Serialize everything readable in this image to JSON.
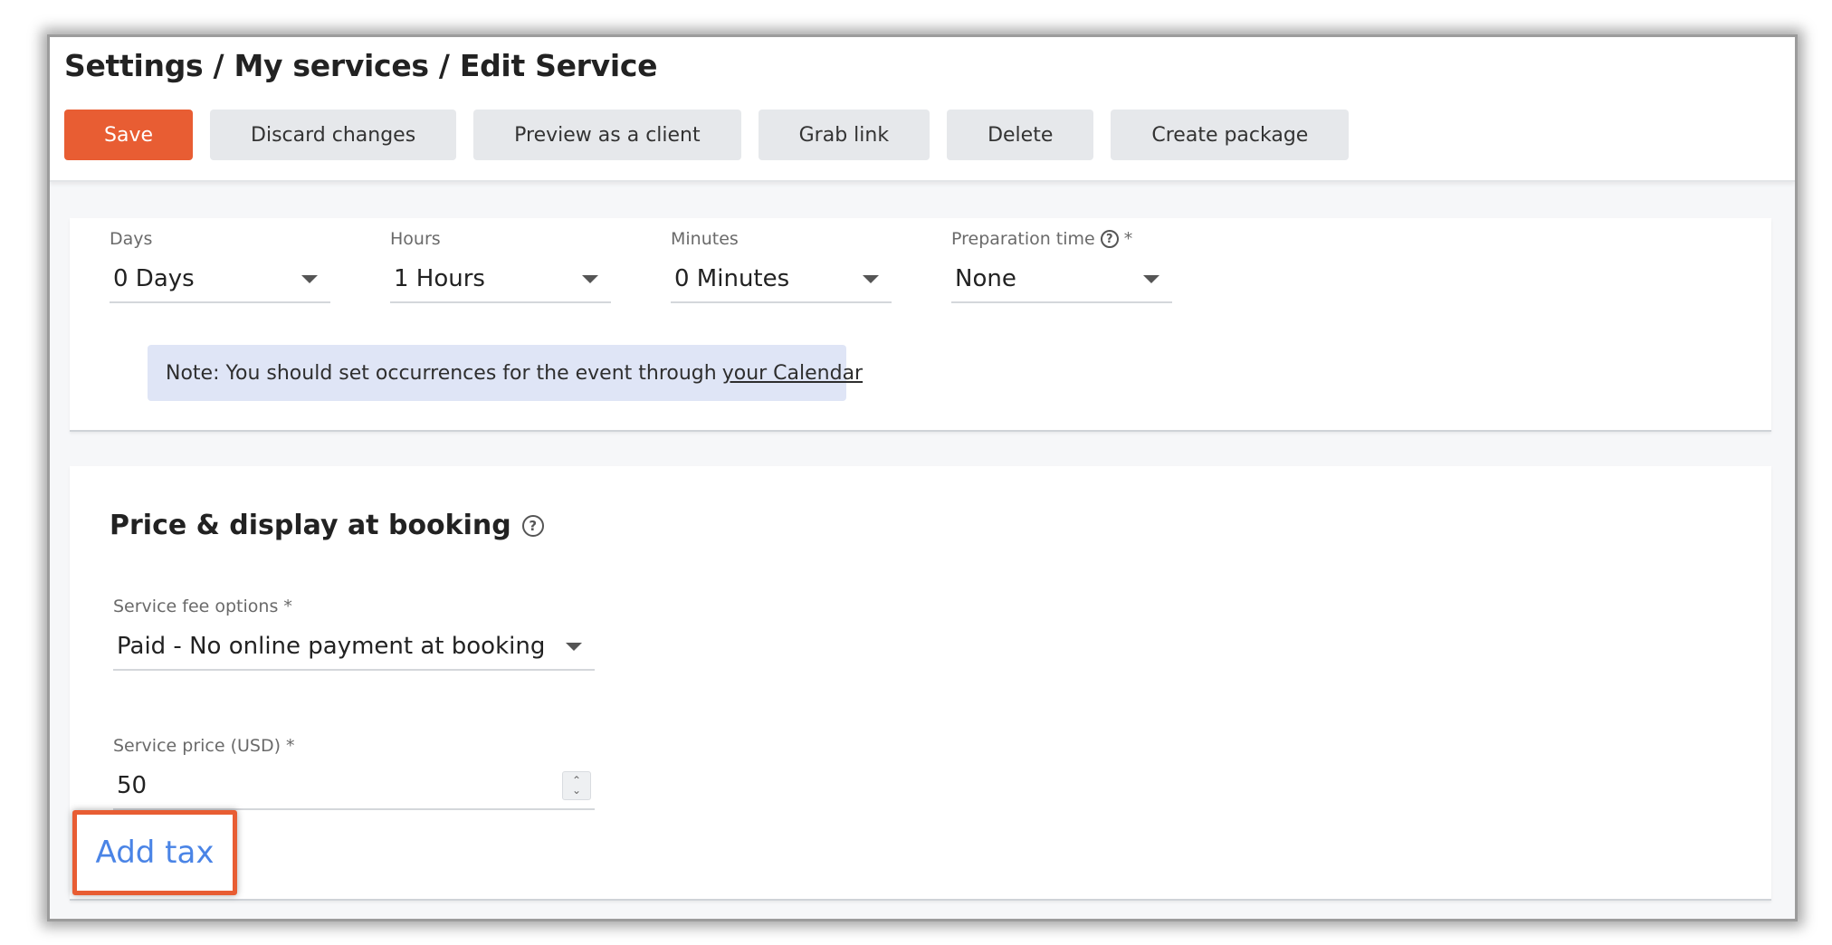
{
  "breadcrumb": "Settings / My services / Edit Service",
  "toolbar": {
    "save": "Save",
    "discard": "Discard changes",
    "preview": "Preview as a client",
    "grab_link": "Grab link",
    "delete": "Delete",
    "create_package": "Create package"
  },
  "duration": {
    "days": {
      "label": "Days",
      "value": "0 Days"
    },
    "hours": {
      "label": "Hours",
      "value": "1 Hours"
    },
    "minutes": {
      "label": "Minutes",
      "value": "0 Minutes"
    },
    "preparation": {
      "label": "Preparation time",
      "required_mark": "*",
      "value": "None"
    }
  },
  "note": {
    "text": "Note: You should set occurrences for the event through",
    "link": "your Calendar"
  },
  "price_section": {
    "title": "Price & display at booking",
    "fee_options": {
      "label": "Service fee options *",
      "value": "Paid - No online payment at booking"
    },
    "price": {
      "label": "Service price (USD) *",
      "value": "50"
    },
    "add_tax": "Add tax"
  },
  "icons": {
    "help": "question-circle-icon",
    "dropdown": "caret-down-icon",
    "stepper": "up-down-stepper-icon"
  },
  "colors": {
    "primary": "#e85d33",
    "link": "#4a84e6",
    "note_bg": "#dfe5f6",
    "secondary_button": "#e6e8eb"
  }
}
